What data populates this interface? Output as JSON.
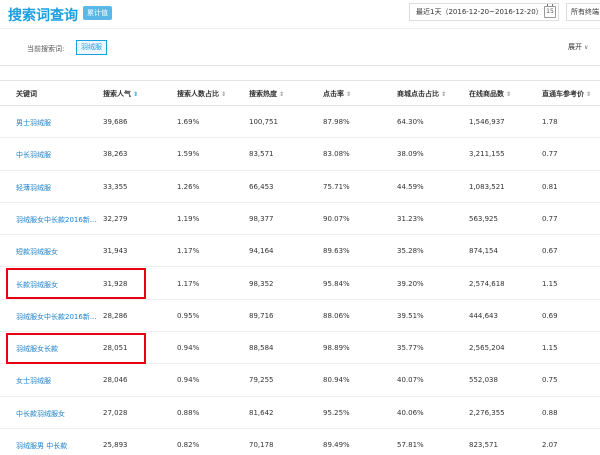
{
  "header": {
    "title": "搜索词查询",
    "badge": "累计值",
    "date_range": "最近1天（2016-12-20~2016-12-20）",
    "calendar_icon": "calendar-icon",
    "calendar_day": "15",
    "device": "所有终端"
  },
  "filter": {
    "label": "当前搜索词:",
    "tag": "羽绒服",
    "expand": "展开",
    "expand_icon": "chevron-down-icon"
  },
  "table": {
    "columns": [
      "关键词",
      "搜索人气",
      "搜索人数占比",
      "搜索热度",
      "点击率",
      "商城点击占比",
      "在线商品数",
      "直通车参考价"
    ],
    "sort_icon": "sort-icon",
    "rows": [
      [
        "男士羽绒服",
        "39,686",
        "1.69%",
        "100,751",
        "87.98%",
        "64.30%",
        "1,546,937",
        "1.78"
      ],
      [
        "中长羽绒服",
        "38,263",
        "1.59%",
        "83,571",
        "83.08%",
        "38.09%",
        "3,211,155",
        "0.77"
      ],
      [
        "轻薄羽绒服",
        "33,355",
        "1.26%",
        "66,453",
        "75.71%",
        "44.59%",
        "1,083,521",
        "0.81"
      ],
      [
        "羽绒服女中长款2016新...",
        "32,279",
        "1.19%",
        "98,377",
        "90.07%",
        "31.23%",
        "563,925",
        "0.77"
      ],
      [
        "短款羽绒服女",
        "31,943",
        "1.17%",
        "94,164",
        "89.63%",
        "35.28%",
        "874,154",
        "0.67"
      ],
      [
        "长款羽绒服女",
        "31,928",
        "1.17%",
        "98,352",
        "95.84%",
        "39.20%",
        "2,574,618",
        "1.15"
      ],
      [
        "羽绒服女中长款2016新...",
        "28,286",
        "0.95%",
        "89,716",
        "88.06%",
        "39.51%",
        "444,643",
        "0.69"
      ],
      [
        "羽绒服女长款",
        "28,051",
        "0.94%",
        "88,584",
        "98.89%",
        "35.77%",
        "2,565,204",
        "1.15"
      ],
      [
        "女士羽绒服",
        "28,046",
        "0.94%",
        "79,255",
        "80.94%",
        "40.07%",
        "552,038",
        "0.75"
      ],
      [
        "中长款羽绒服女",
        "27,028",
        "0.88%",
        "81,642",
        "95.25%",
        "40.06%",
        "2,276,355",
        "0.88"
      ],
      [
        "羽绒服男 中长款",
        "25,893",
        "0.82%",
        "70,178",
        "89.49%",
        "57.81%",
        "823,571",
        "2.07"
      ]
    ],
    "highlight_color": "#e60012"
  }
}
